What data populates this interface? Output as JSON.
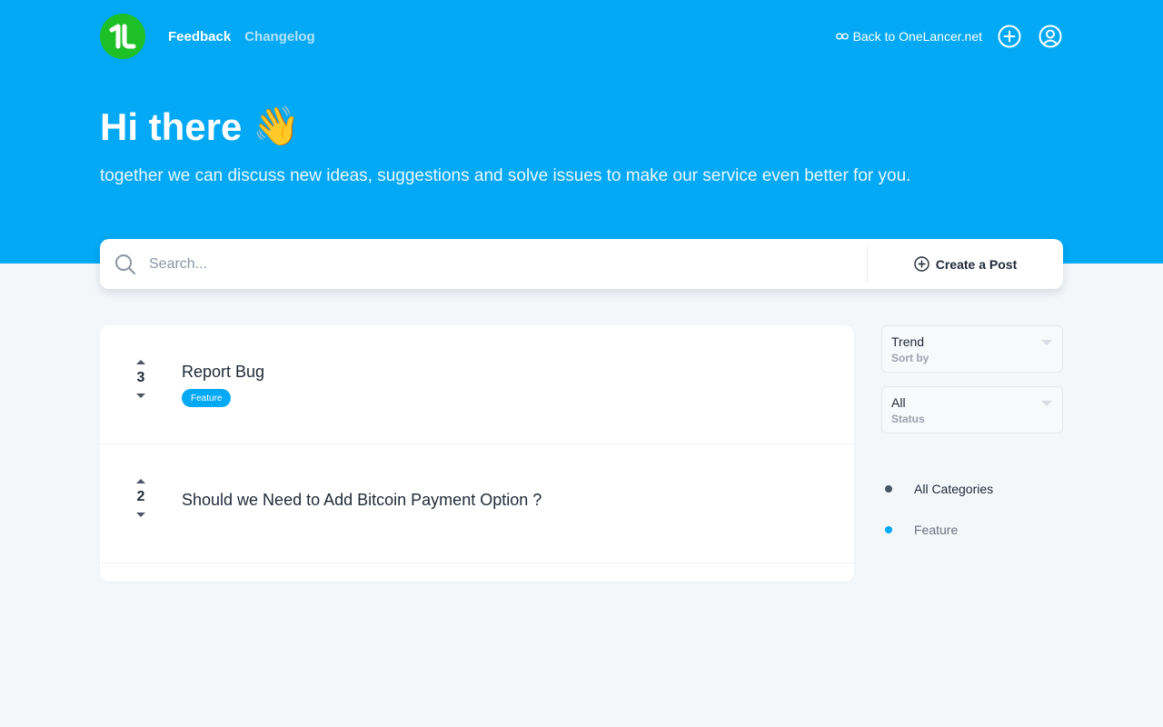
{
  "colors": {
    "brand": "#03a9f4",
    "logo": "#1ec028",
    "tag": "#03a9f4"
  },
  "header": {
    "logo_text": "1L",
    "nav": [
      {
        "label": "Feedback",
        "active": true
      },
      {
        "label": "Changelog",
        "active": false
      }
    ],
    "back_link": "Back to OneLancer.net",
    "link_icon": "link-icon",
    "add_icon": "plus-circle-icon",
    "user_icon": "user-circle-icon"
  },
  "hero": {
    "title": "Hi there",
    "emoji": "👋",
    "subtitle": "together we can discuss new ideas, suggestions and solve issues to make our service even better for you."
  },
  "search": {
    "placeholder": "Search...",
    "value": "",
    "create_label": "Create a Post"
  },
  "posts": [
    {
      "votes": "3",
      "title": "Report Bug",
      "tag": "Feature"
    },
    {
      "votes": "2",
      "title": "Should we Need to Add Bitcoin Payment Option ?",
      "tag": ""
    }
  ],
  "filters": {
    "sort": {
      "value": "Trend",
      "label": "Sort by"
    },
    "status": {
      "value": "All",
      "label": "Status"
    }
  },
  "categories": [
    {
      "label": "All Categories",
      "color": "#4b5563",
      "selected": true
    },
    {
      "label": "Feature",
      "color": "#03a9f4",
      "selected": false
    }
  ]
}
